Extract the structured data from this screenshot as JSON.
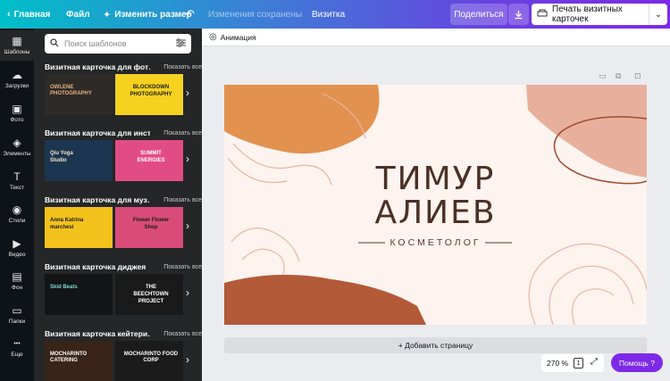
{
  "topbar": {
    "home_label": "Главная",
    "file_label": "Файл",
    "resize_label": "Изменить размер",
    "saved_status": "Изменения сохранены",
    "doc_title": "Визитка",
    "share_label": "Поделиться",
    "print_label": "Печать визитных карточек"
  },
  "rail": [
    {
      "label": "Шаблоны",
      "icon": "grid-icon"
    },
    {
      "label": "Загрузки",
      "icon": "cloud-upload-icon"
    },
    {
      "label": "Фото",
      "icon": "photo-icon"
    },
    {
      "label": "Элементы",
      "icon": "shapes-icon"
    },
    {
      "label": "Текст",
      "icon": "text-icon"
    },
    {
      "label": "Стили",
      "icon": "palette-icon"
    },
    {
      "label": "Видео",
      "icon": "video-icon"
    },
    {
      "label": "Фон",
      "icon": "background-icon"
    },
    {
      "label": "Папки",
      "icon": "folder-icon"
    },
    {
      "label": "Еще",
      "icon": "more-icon"
    }
  ],
  "panel": {
    "search_placeholder": "Поиск шаблонов",
    "show_all": "Показать все",
    "sections": [
      {
        "title": "Визитная карточка для фот…",
        "t1": [
          "OWLENE PHOTOGRAPHY"
        ],
        "t2": [
          "BLOCKDOWN",
          "PHOTOGRAPHY"
        ]
      },
      {
        "title": "Визитная карточка для инст…",
        "t1": [
          "Qiu Yoga",
          "Studio"
        ],
        "t2": [
          "SUMMIT",
          "ENERGIES"
        ]
      },
      {
        "title": "Визитная карточка для муз…",
        "t1": [
          "Anna Katrina",
          "marchesi"
        ],
        "t2": [
          "Flower Flower",
          "Shop"
        ]
      },
      {
        "title": "Визитная карточка диджея",
        "t1": [
          "Skid Beats"
        ],
        "t2": [
          "THE",
          "BEECHTOWN",
          "PROJECT"
        ]
      },
      {
        "title": "Визитная карточка кейтери…",
        "t1": [
          "MOCHARINTO CATERING"
        ],
        "t2": [
          "MOCHARINTO FOOD CORP"
        ]
      }
    ]
  },
  "toolbar": {
    "animation_label": "Анимация"
  },
  "card": {
    "name_line1": "ТИМУР",
    "name_line2": "АЛИЕВ",
    "profession": "КОСМЕТОЛОГ",
    "colors": {
      "bg": "#fdf3ef",
      "orange": "#e3914e",
      "rust": "#b35a38",
      "pink": "#e8b09c",
      "text": "#4a3026"
    }
  },
  "bottom": {
    "add_page_label": "+ Добавить страницу",
    "zoom": "270 %",
    "page_number": "1",
    "help_label": "Помощь  ?"
  }
}
